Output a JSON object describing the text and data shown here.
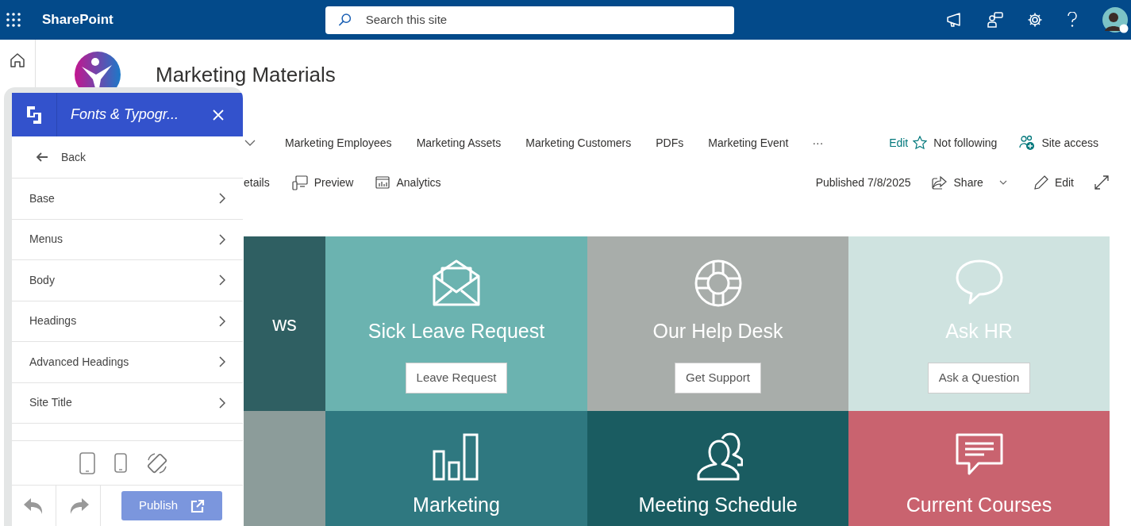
{
  "top_bar": {
    "app_name": "SharePoint",
    "search": {
      "placeholder": "Search this site"
    }
  },
  "site": {
    "title": "Marketing Materials"
  },
  "nav": {
    "links": [
      "Marketing Employees",
      "Marketing Assets",
      "Marketing Customers",
      "PDFs",
      "Marketing Event"
    ],
    "more": "···",
    "edit": "Edit",
    "follow": {
      "label": "Not following",
      "following": false
    },
    "site_access": "Site access"
  },
  "command_bar": {
    "left": [
      {
        "label": "etails",
        "kind": "text"
      },
      {
        "label": "Preview",
        "kind": "preview"
      },
      {
        "label": "Analytics",
        "kind": "analytics"
      }
    ],
    "published": "Published 7/8/2025",
    "share": "Share",
    "edit": "Edit"
  },
  "tiles": [
    {
      "title": "ws",
      "color": "#2f5f62"
    },
    {
      "title": "Sick Leave Request",
      "button": "Leave Request",
      "kind": "envelope",
      "color": "#6bb3b0"
    },
    {
      "title": "Our Help Desk",
      "button": "Get Support",
      "kind": "lifebuoy",
      "color": "#a8adaa"
    },
    {
      "title": "Ask HR",
      "button": "Ask a Question",
      "kind": "speech",
      "color": "#cfe3e0"
    },
    {
      "color": "#8c9c9a"
    },
    {
      "title": "Marketing",
      "kind": "chart",
      "color": "#2f7880"
    },
    {
      "title": "Meeting Schedule",
      "kind": "people",
      "color": "#1a5c61"
    },
    {
      "title": "Current Courses",
      "kind": "message",
      "color": "#c9636f"
    }
  ],
  "panel": {
    "title": "Fonts & Typogr...",
    "back": "Back",
    "items": [
      "Base",
      "Menus",
      "Body",
      "Headings",
      "Advanced Headings",
      "Site Title"
    ],
    "publish": "Publish"
  }
}
